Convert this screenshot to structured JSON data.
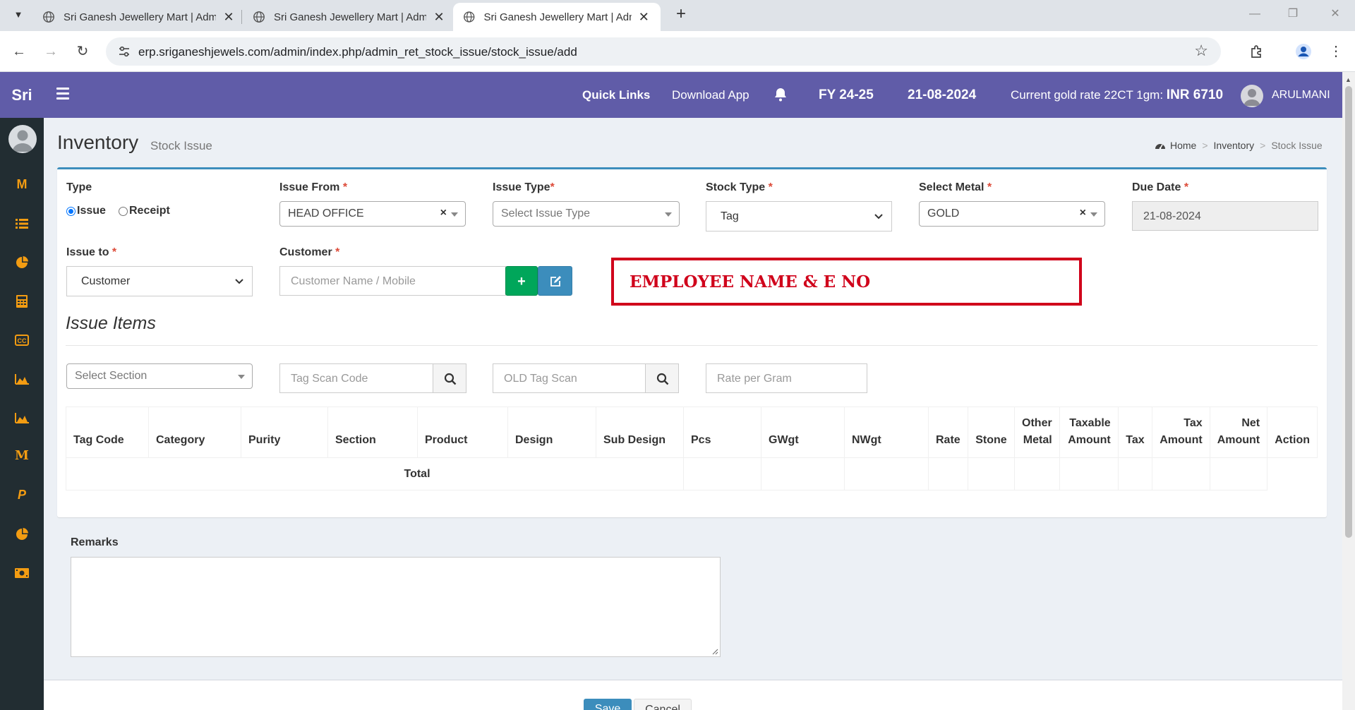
{
  "browser": {
    "tabs": [
      {
        "title": "Sri Ganesh Jewellery Mart | Adm"
      },
      {
        "title": "Sri Ganesh Jewellery Mart | Adm"
      },
      {
        "title": "Sri Ganesh Jewellery Mart | Adm"
      }
    ],
    "url": "erp.sriganeshjewels.com/admin/index.php/admin_ret_stock_issue/stock_issue/add"
  },
  "header": {
    "logo": "Sri",
    "quick_links": "Quick Links",
    "download_app": "Download App",
    "fy": "FY 24-25",
    "date": "21-08-2024",
    "gold_rate_label": "Current gold rate 22CT 1gm: ",
    "gold_rate_value": "INR 6710",
    "user": "ARULMANI"
  },
  "sidebar": {
    "icons": [
      "m-icon",
      "list-icon",
      "pie-chart-icon",
      "calculator-icon",
      "cc-icon",
      "area-chart-icon",
      "area-chart-icon",
      "m-icon",
      "p-icon",
      "pie-chart-icon",
      "money-icon"
    ]
  },
  "page": {
    "title": "Inventory",
    "subtitle": "Stock Issue",
    "breadcrumb": [
      "Home",
      "Inventory",
      "Stock Issue"
    ]
  },
  "form": {
    "type_label": "Type",
    "type_issue": "Issue",
    "type_receipt": "Receipt",
    "issue_from_label": "Issue From",
    "issue_from_value": "HEAD OFFICE",
    "issue_type_label": "Issue Type",
    "issue_type_placeholder": "Select Issue Type",
    "stock_type_label": "Stock Type",
    "stock_type_value": "Tag",
    "metal_label": "Select Metal",
    "metal_value": "GOLD",
    "due_date_label": "Due Date",
    "due_date_value": "21-08-2024",
    "issue_to_label": "Issue to",
    "issue_to_value": "Customer",
    "customer_label": "Customer",
    "customer_placeholder": "Customer Name / Mobile",
    "required_mark": "*"
  },
  "annotation": "EMPLOYEE NAME & E NO",
  "items": {
    "title": "Issue Items",
    "section_placeholder": "Select Section",
    "tag_scan_placeholder": "Tag Scan Code",
    "old_tag_placeholder": "OLD Tag Scan",
    "rate_placeholder": "Rate per Gram",
    "columns": [
      {
        "line1": "",
        "line2": "Tag Code"
      },
      {
        "line1": "",
        "line2": "Category"
      },
      {
        "line1": "",
        "line2": "Purity"
      },
      {
        "line1": "",
        "line2": "Section"
      },
      {
        "line1": "",
        "line2": "Product"
      },
      {
        "line1": "",
        "line2": "Design"
      },
      {
        "line1": "",
        "line2": "Sub Design"
      },
      {
        "line1": "",
        "line2": "Pcs"
      },
      {
        "line1": "",
        "line2": "GWgt"
      },
      {
        "line1": "",
        "line2": "NWgt"
      },
      {
        "line1": "",
        "line2": "Rate"
      },
      {
        "line1": "",
        "line2": "Stone"
      },
      {
        "line1": "Other",
        "line2": "Metal"
      },
      {
        "line1": "Taxable",
        "line2": "Amount"
      },
      {
        "line1": "",
        "line2": "Tax"
      },
      {
        "line1": "Tax",
        "line2": "Amount"
      },
      {
        "line1": "Net",
        "line2": "Amount"
      },
      {
        "line1": "",
        "line2": "Action"
      }
    ],
    "total_label": "Total"
  },
  "remarks_label": "Remarks",
  "footer": {
    "save": "Save",
    "cancel": "Cancel"
  },
  "colors": {
    "header_bg": "#605ca8",
    "sidebar_bg": "#222d32",
    "sidebar_icon": "#f39c12",
    "box_border": "#3c8dbc",
    "annotation": "#d0021b"
  }
}
